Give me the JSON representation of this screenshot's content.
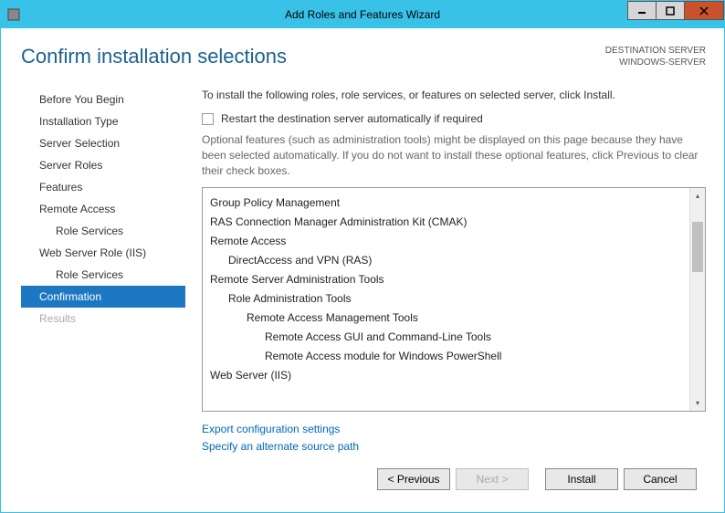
{
  "window": {
    "title": "Add Roles and Features Wizard"
  },
  "header": {
    "page_title": "Confirm installation selections",
    "dest_label": "DESTINATION SERVER",
    "dest_value": "WINDOWS-SERVER"
  },
  "sidebar": {
    "items": [
      {
        "label": "Before You Begin",
        "indent": 0,
        "active": false,
        "disabled": false
      },
      {
        "label": "Installation Type",
        "indent": 0,
        "active": false,
        "disabled": false
      },
      {
        "label": "Server Selection",
        "indent": 0,
        "active": false,
        "disabled": false
      },
      {
        "label": "Server Roles",
        "indent": 0,
        "active": false,
        "disabled": false
      },
      {
        "label": "Features",
        "indent": 0,
        "active": false,
        "disabled": false
      },
      {
        "label": "Remote Access",
        "indent": 0,
        "active": false,
        "disabled": false
      },
      {
        "label": "Role Services",
        "indent": 1,
        "active": false,
        "disabled": false
      },
      {
        "label": "Web Server Role (IIS)",
        "indent": 0,
        "active": false,
        "disabled": false
      },
      {
        "label": "Role Services",
        "indent": 1,
        "active": false,
        "disabled": false
      },
      {
        "label": "Confirmation",
        "indent": 0,
        "active": true,
        "disabled": false
      },
      {
        "label": "Results",
        "indent": 0,
        "active": false,
        "disabled": true
      }
    ]
  },
  "main": {
    "instruction": "To install the following roles, role services, or features on selected server, click Install.",
    "restart_label": "Restart the destination server automatically if required",
    "optional_note": "Optional features (such as administration tools) might be displayed on this page because they have been selected automatically. If you do not want to install these optional features, click Previous to clear their check boxes.",
    "listbox": [
      {
        "text": "Group Policy Management",
        "indent": 0
      },
      {
        "text": "RAS Connection Manager Administration Kit (CMAK)",
        "indent": 0
      },
      {
        "text": "Remote Access",
        "indent": 0
      },
      {
        "text": "DirectAccess and VPN (RAS)",
        "indent": 1
      },
      {
        "text": "Remote Server Administration Tools",
        "indent": 0
      },
      {
        "text": "Role Administration Tools",
        "indent": 1
      },
      {
        "text": "Remote Access Management Tools",
        "indent": 2
      },
      {
        "text": "Remote Access GUI and Command-Line Tools",
        "indent": 3
      },
      {
        "text": "Remote Access module for Windows PowerShell",
        "indent": 3
      },
      {
        "text": "Web Server (IIS)",
        "indent": 0
      }
    ],
    "link_export": "Export configuration settings",
    "link_source": "Specify an alternate source path"
  },
  "footer": {
    "previous": "< Previous",
    "next": "Next >",
    "install": "Install",
    "cancel": "Cancel"
  }
}
